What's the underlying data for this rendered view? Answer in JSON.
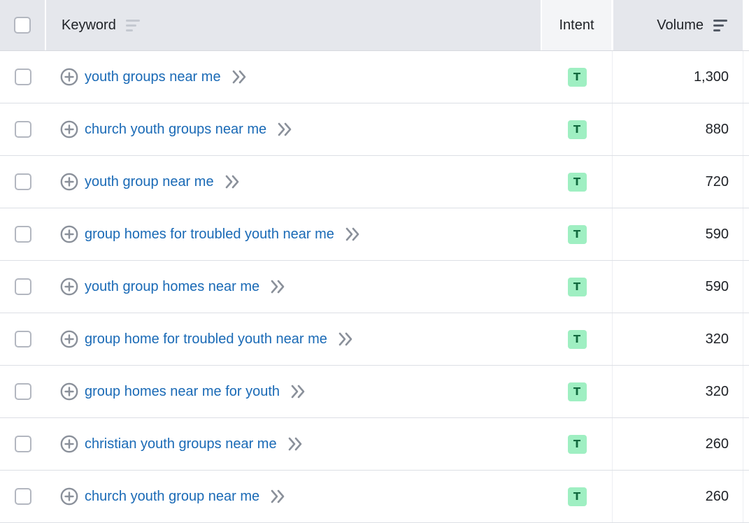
{
  "header": {
    "keyword_label": "Keyword",
    "intent_label": "Intent",
    "volume_label": "Volume"
  },
  "colors": {
    "link": "#1a6ab6",
    "intent_badge_bg": "#9fefc2",
    "intent_badge_text": "#126a3f",
    "header_bg": "#e5e7ec"
  },
  "icons": {
    "add": "plus-circle-icon",
    "expand": "double-chevron-right-icon",
    "sort": "sort-lines-icon"
  },
  "rows": [
    {
      "keyword": "youth groups near me",
      "intent": "T",
      "volume": "1,300"
    },
    {
      "keyword": "church youth groups near me",
      "intent": "T",
      "volume": "880"
    },
    {
      "keyword": "youth group near me",
      "intent": "T",
      "volume": "720"
    },
    {
      "keyword": "group homes for troubled youth near me",
      "intent": "T",
      "volume": "590"
    },
    {
      "keyword": "youth group homes near me",
      "intent": "T",
      "volume": "590"
    },
    {
      "keyword": "group home for troubled youth near me",
      "intent": "T",
      "volume": "320"
    },
    {
      "keyword": "group homes near me for youth",
      "intent": "T",
      "volume": "320"
    },
    {
      "keyword": "christian youth groups near me",
      "intent": "T",
      "volume": "260"
    },
    {
      "keyword": "church youth group near me",
      "intent": "T",
      "volume": "260"
    }
  ]
}
